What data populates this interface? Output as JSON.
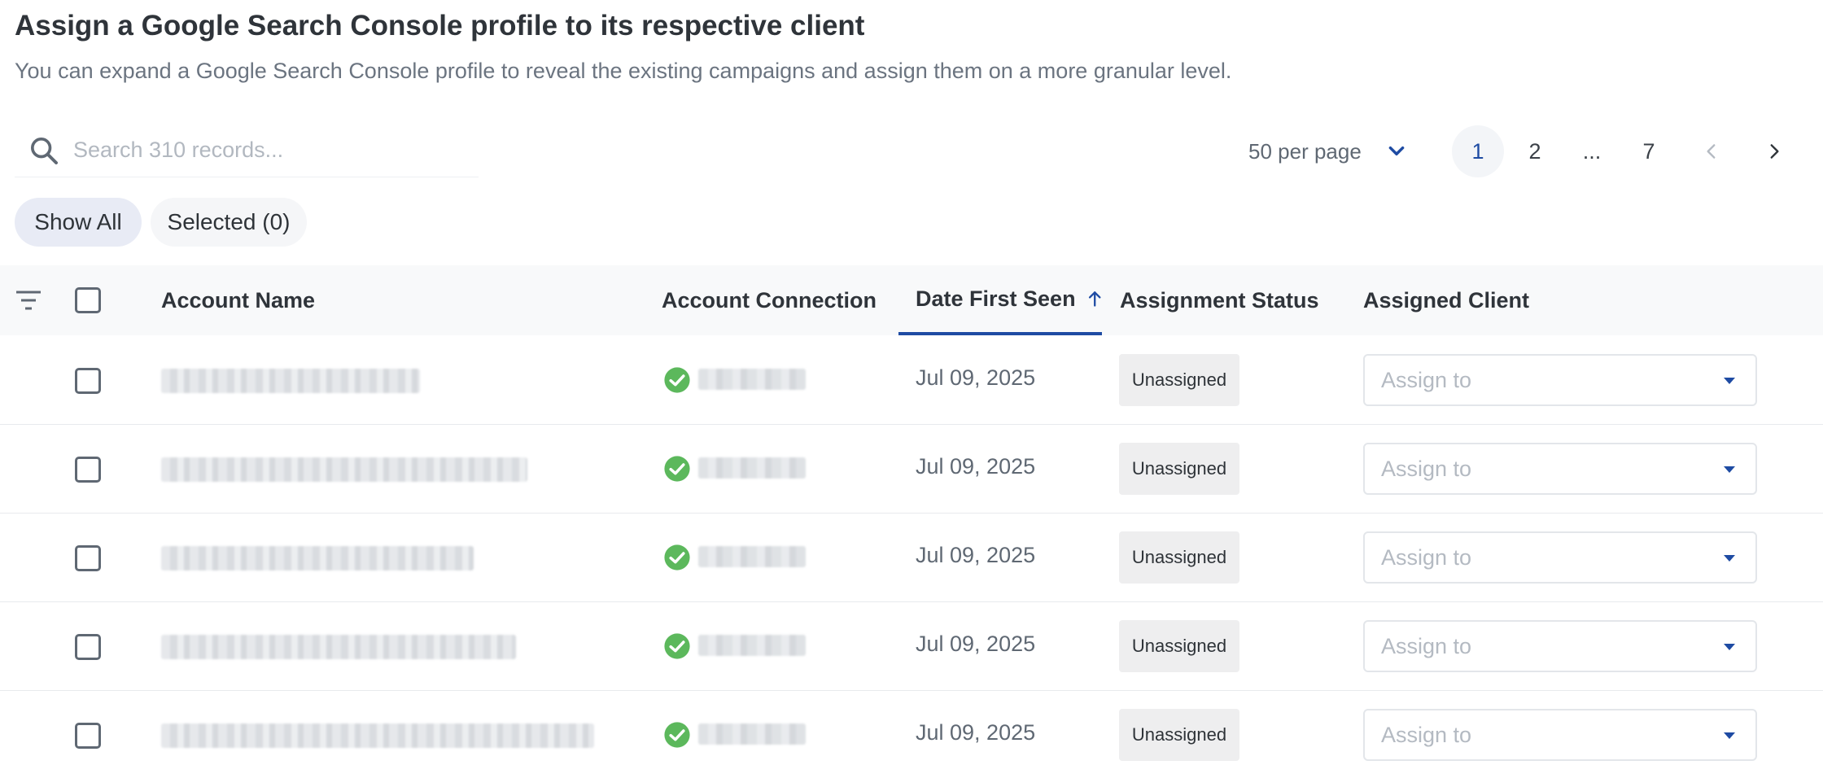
{
  "header": {
    "title": "Assign a Google Search Console profile to its respective client",
    "subtitle": "You can expand a Google Search Console profile to reveal the existing campaigns and assign them on a more granular level."
  },
  "search": {
    "placeholder": "Search 310 records...",
    "value": "",
    "icon": "search-icon"
  },
  "per_page": {
    "label": "50 per page",
    "icon": "chevron-down-icon"
  },
  "pagination": {
    "pages": [
      "1",
      "2",
      "...",
      "7"
    ],
    "current": "1",
    "prev_icon": "chevron-left-icon",
    "next_icon": "chevron-right-icon"
  },
  "filters": {
    "show_all": "Show All",
    "selected": "Selected (0)"
  },
  "table": {
    "columns": {
      "account_name": "Account Name",
      "account_connection": "Account Connection",
      "date_first_seen": "Date First Seen",
      "assignment_status": "Assignment Status",
      "assigned_client": "Assigned Client"
    },
    "sort_icon": "arrow-up-icon",
    "rows": [
      {
        "date": "Jul 09, 2025",
        "status": "Unassigned",
        "assign_placeholder": "Assign to"
      },
      {
        "date": "Jul 09, 2025",
        "status": "Unassigned",
        "assign_placeholder": "Assign to"
      },
      {
        "date": "Jul 09, 2025",
        "status": "Unassigned",
        "assign_placeholder": "Assign to"
      },
      {
        "date": "Jul 09, 2025",
        "status": "Unassigned",
        "assign_placeholder": "Assign to"
      },
      {
        "date": "Jul 09, 2025",
        "status": "Unassigned",
        "assign_placeholder": "Assign to"
      }
    ]
  },
  "colors": {
    "accent": "#1e4ba3",
    "success": "#5cb85c",
    "chip_active": "#e8ebf5"
  }
}
